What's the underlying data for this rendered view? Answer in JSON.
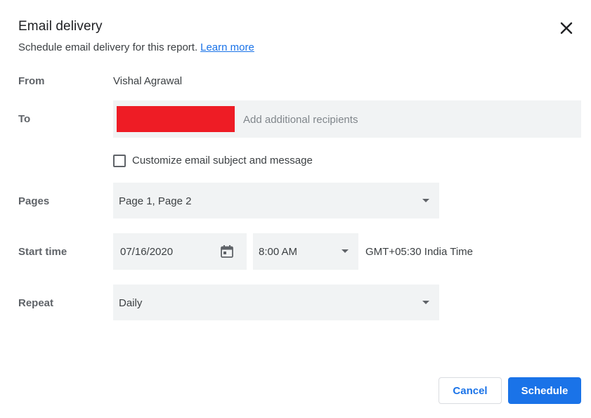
{
  "dialog": {
    "title": "Email delivery",
    "subtitle": "Schedule email delivery for this report.",
    "learn_more": "Learn more"
  },
  "from": {
    "label": "From",
    "value": "Vishal Agrawal"
  },
  "to": {
    "label": "To",
    "placeholder": "Add additional recipients",
    "redacted_color": "#ee1c25"
  },
  "customize": {
    "label": "Customize email subject and message",
    "checked": false
  },
  "pages": {
    "label": "Pages",
    "value": "Page 1, Page 2"
  },
  "start_time": {
    "label": "Start time",
    "date": "07/16/2020",
    "time": "8:00 AM",
    "timezone": "GMT+05:30 India Time"
  },
  "repeat": {
    "label": "Repeat",
    "value": "Daily"
  },
  "actions": {
    "cancel": "Cancel",
    "schedule": "Schedule"
  },
  "icons": {
    "close": "close-icon",
    "calendar": "calendar-icon",
    "dropdown": "chevron-down-icon"
  },
  "colors": {
    "accent": "#1a73e8",
    "field_bg": "#f1f3f4"
  }
}
